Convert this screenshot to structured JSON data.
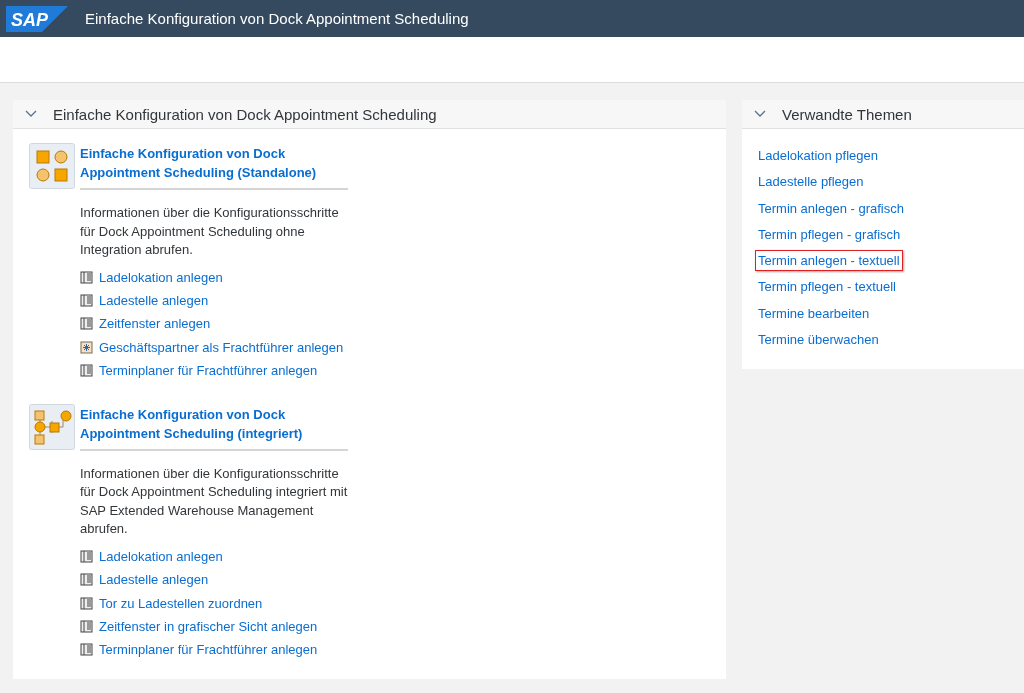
{
  "shell": {
    "logo": "SAP",
    "title": "Einfache Konfiguration von Dock Appointment Scheduling"
  },
  "main_panel": {
    "title": "Einfache Konfiguration von Dock Appointment Scheduling",
    "expanded": true,
    "groups": [
      {
        "kind": "standalone",
        "title": "Einfache Konfiguration von Dock Appointment Scheduling (Standalone)",
        "description": "Informationen über die Konfigurationsschritte für Dock Appointment Scheduling ohne Integration abrufen.",
        "links": [
          {
            "kind": "transaction",
            "label": "Ladelokation anlegen"
          },
          {
            "kind": "transaction",
            "label": "Ladestelle anlegen"
          },
          {
            "kind": "transaction",
            "label": "Zeitfenster anlegen"
          },
          {
            "kind": "partner",
            "label": "Geschäftspartner als Frachtführer anlegen"
          },
          {
            "kind": "transaction",
            "label": "Terminplaner für Frachtführer anlegen"
          }
        ]
      },
      {
        "kind": "integrated",
        "title": "Einfache Konfiguration von Dock Appointment Scheduling (integriert)",
        "description": "Informationen über die Konfigurationsschritte für Dock Appointment Scheduling integriert mit SAP Extended Warehouse Management abrufen.",
        "links": [
          {
            "kind": "transaction",
            "label": "Ladelokation anlegen"
          },
          {
            "kind": "transaction",
            "label": "Ladestelle anlegen"
          },
          {
            "kind": "transaction",
            "label": "Tor zu Ladestellen zuordnen"
          },
          {
            "kind": "transaction",
            "label": "Zeitfenster in grafischer Sicht anlegen"
          },
          {
            "kind": "transaction",
            "label": "Terminplaner für Frachtführer anlegen"
          }
        ]
      }
    ]
  },
  "related_panel": {
    "title": "Verwandte Themen",
    "expanded": true,
    "links": [
      {
        "label": "Ladelokation pflegen",
        "highlighted": false
      },
      {
        "label": "Ladestelle pflegen",
        "highlighted": false
      },
      {
        "label": "Termin anlegen - grafisch",
        "highlighted": false
      },
      {
        "label": "Termin pflegen - grafisch",
        "highlighted": false
      },
      {
        "label": "Termin anlegen - textuell",
        "highlighted": true
      },
      {
        "label": "Termin pflegen - textuell",
        "highlighted": false
      },
      {
        "label": "Termine bearbeiten",
        "highlighted": false
      },
      {
        "label": "Termine überwachen",
        "highlighted": false
      }
    ]
  }
}
